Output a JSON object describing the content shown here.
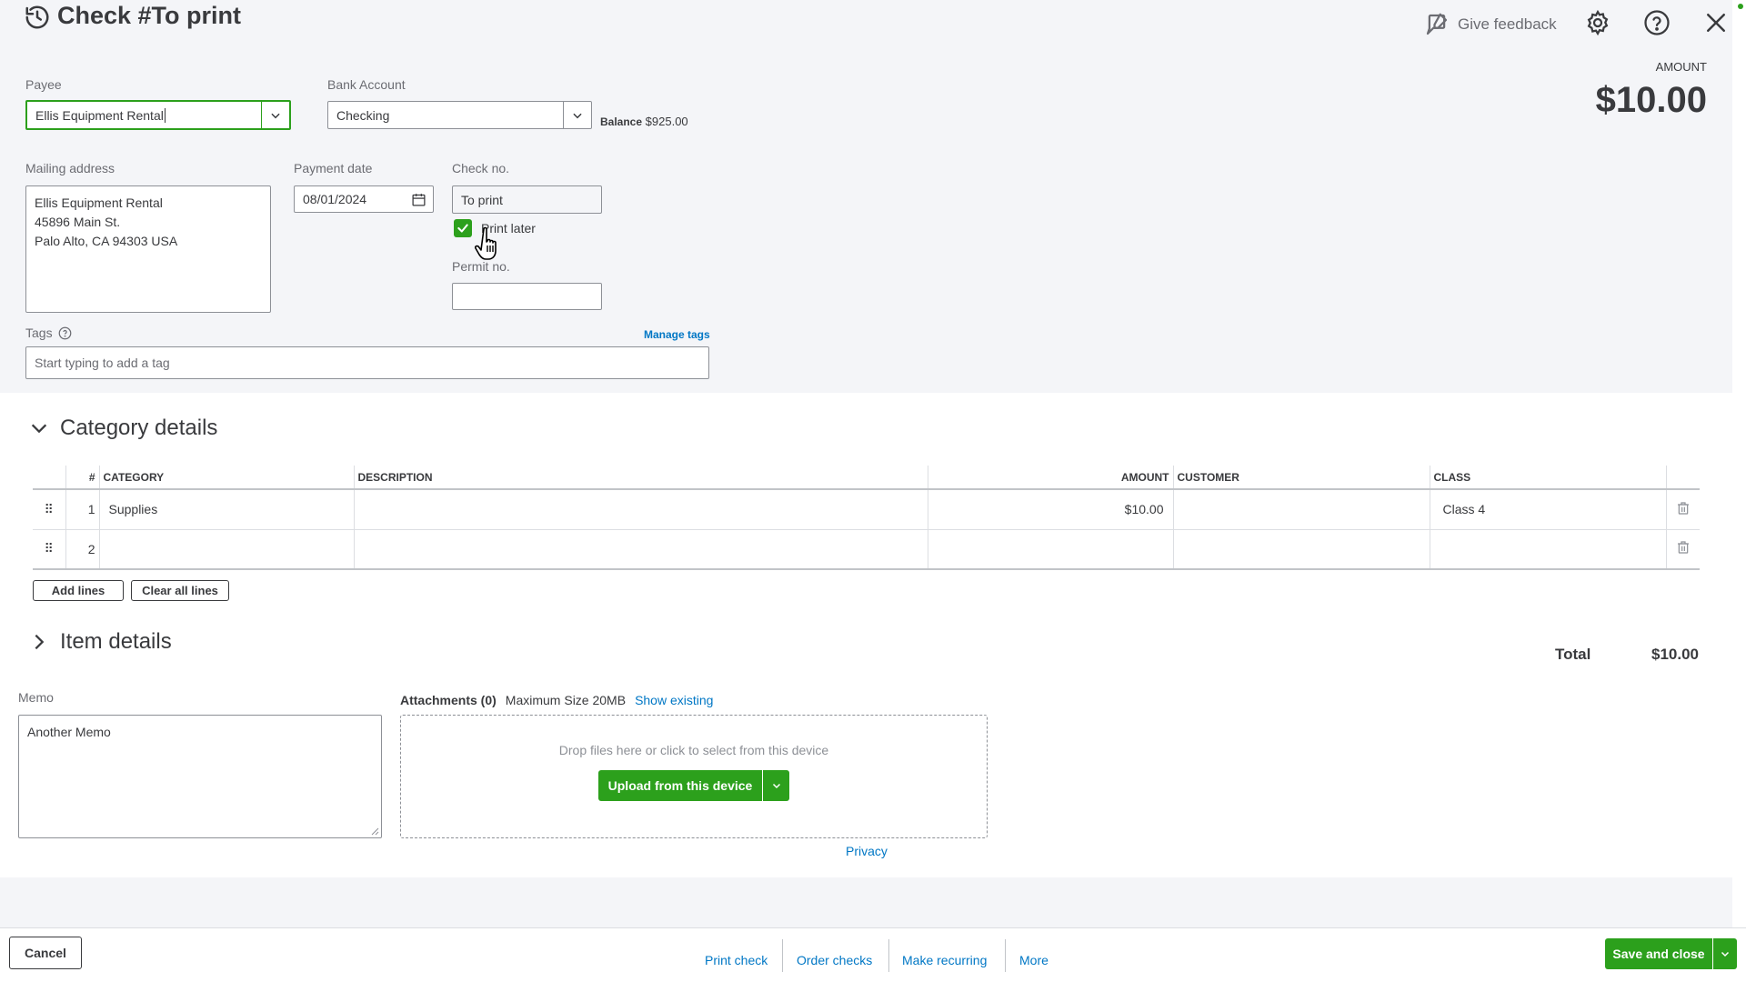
{
  "header": {
    "title": "Check #To print",
    "feedback_label": "Give feedback"
  },
  "amount": {
    "label": "AMOUNT",
    "value": "$10.00"
  },
  "payee": {
    "label": "Payee",
    "value": "Ellis Equipment Rental"
  },
  "bank_account": {
    "label": "Bank Account",
    "value": "Checking",
    "balance_label": "Balance",
    "balance_value": "$925.00"
  },
  "mailing_address": {
    "label": "Mailing address",
    "lines": [
      "Ellis Equipment Rental",
      "45896 Main St.",
      "Palo Alto, CA  94303 USA"
    ]
  },
  "payment_date": {
    "label": "Payment date",
    "value": "08/01/2024"
  },
  "check_no": {
    "label": "Check no.",
    "value": "To print",
    "print_later_label": "Print later",
    "print_later_checked": true
  },
  "permit_no": {
    "label": "Permit no.",
    "value": ""
  },
  "tags": {
    "label": "Tags",
    "manage_label": "Manage tags",
    "placeholder": "Start typing to add a tag"
  },
  "category_details": {
    "title": "Category details",
    "columns": [
      "#",
      "CATEGORY",
      "DESCRIPTION",
      "AMOUNT",
      "CUSTOMER",
      "CLASS"
    ],
    "rows": [
      {
        "num": "1",
        "category": "Supplies",
        "description": "",
        "amount": "$10.00",
        "customer": "",
        "class": "Class 4"
      },
      {
        "num": "2",
        "category": "",
        "description": "",
        "amount": "",
        "customer": "",
        "class": ""
      }
    ],
    "add_lines_label": "Add lines",
    "clear_lines_label": "Clear all lines"
  },
  "item_details": {
    "title": "Item details"
  },
  "total": {
    "label": "Total",
    "value": "$10.00"
  },
  "memo": {
    "label": "Memo",
    "value": "Another Memo"
  },
  "attachments": {
    "label": "Attachments (0)",
    "max_size": "Maximum Size 20MB",
    "show_existing": "Show existing",
    "drop_text": "Drop files here or click to select from this device",
    "upload_label": "Upload from this device",
    "privacy_label": "Privacy"
  },
  "footer": {
    "cancel_label": "Cancel",
    "print_check_label": "Print check",
    "order_checks_label": "Order checks",
    "make_recurring_label": "Make recurring",
    "more_label": "More",
    "save_close_label": "Save and close"
  },
  "colors": {
    "accent": "#2ca01c",
    "link": "#0077c5",
    "text": "#393a3d",
    "background_gray": "#f4f5f8"
  }
}
